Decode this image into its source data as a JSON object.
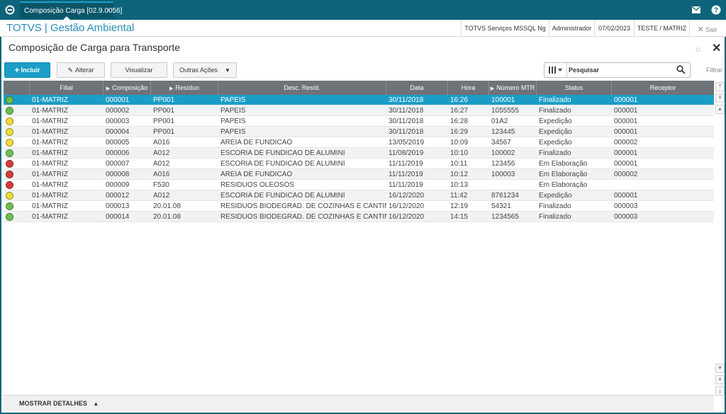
{
  "topbar": {
    "tab_label": "Composição Carga [02.9.0056]",
    "tab_close": "×"
  },
  "header": {
    "app_title": "TOTVS | Gestão Ambiental",
    "environment": "TOTVS Serviços MSSQL Ng",
    "user": "Administrador",
    "date": "07/02/2023",
    "company": "TESTE / MATRIZ",
    "exit_label": "Sair"
  },
  "page": {
    "title": "Composição de Carga para Transporte"
  },
  "toolbar": {
    "incluir": "Incluir",
    "alterar": "Alterar",
    "visualizar": "Visualizar",
    "outras_acoes": "Outras Ações",
    "search_placeholder": "Pesquisar",
    "filtrar": "Filtrar"
  },
  "grid": {
    "columns": [
      "",
      "Filial",
      "Composição",
      "Resíduo",
      "Desc. Resíd.",
      "Data",
      "Hora",
      "Número MTR",
      "Status",
      "Receptor"
    ],
    "rows": [
      {
        "status_color": "#6cc04a",
        "filial": "01-MATRIZ",
        "composicao": "000001",
        "residuo": "PP001",
        "desc": "PAPEIS",
        "data": "30/11/2018",
        "hora": "16:26",
        "mtr": "100001",
        "status": "Finalizado",
        "receptor": "000001"
      },
      {
        "status_color": "#6cc04a",
        "filial": "01-MATRIZ",
        "composicao": "000002",
        "residuo": "PP001",
        "desc": "PAPEIS",
        "data": "30/11/2018",
        "hora": "16:27",
        "mtr": "1055555",
        "status": "Finalizado",
        "receptor": "000001"
      },
      {
        "status_color": "#f0dc3c",
        "filial": "01-MATRIZ",
        "composicao": "000003",
        "residuo": "PP001",
        "desc": "PAPEIS",
        "data": "30/11/2018",
        "hora": "16:28",
        "mtr": "01A2",
        "status": "Expedição",
        "receptor": "000001"
      },
      {
        "status_color": "#f0dc3c",
        "filial": "01-MATRIZ",
        "composicao": "000004",
        "residuo": "PP001",
        "desc": "PAPEIS",
        "data": "30/11/2018",
        "hora": "16:29",
        "mtr": "123445",
        "status": "Expedição",
        "receptor": "000001"
      },
      {
        "status_color": "#f0dc3c",
        "filial": "01-MATRIZ",
        "composicao": "000005",
        "residuo": "A016",
        "desc": "AREIA DE FUNDICAO",
        "data": "13/05/2019",
        "hora": "10:09",
        "mtr": "34567",
        "status": "Expedição",
        "receptor": "000002"
      },
      {
        "status_color": "#6cc04a",
        "filial": "01-MATRIZ",
        "composicao": "000006",
        "residuo": "A012",
        "desc": "ESCORIA DE FUNDICAO DE ALUMINI",
        "data": "11/08/2019",
        "hora": "10:10",
        "mtr": "100002",
        "status": "Finalizado",
        "receptor": "000001"
      },
      {
        "status_color": "#d83a3a",
        "filial": "01-MATRIZ",
        "composicao": "000007",
        "residuo": "A012",
        "desc": "ESCORIA DE FUNDICAO DE ALUMINI",
        "data": "11/11/2019",
        "hora": "10:11",
        "mtr": "123456",
        "status": "Em Elaboração",
        "receptor": "000001"
      },
      {
        "status_color": "#d83a3a",
        "filial": "01-MATRIZ",
        "composicao": "000008",
        "residuo": "A016",
        "desc": "AREIA DE FUNDICAO",
        "data": "11/11/2019",
        "hora": "10:12",
        "mtr": "100003",
        "status": "Em Elaboração",
        "receptor": "000002"
      },
      {
        "status_color": "#d83a3a",
        "filial": "01-MATRIZ",
        "composicao": "000009",
        "residuo": "F530",
        "desc": "RESIDUOS OLEOSOS",
        "data": "11/11/2019",
        "hora": "10:13",
        "mtr": "",
        "status": "Em Elaboração",
        "receptor": ""
      },
      {
        "status_color": "#f0dc3c",
        "filial": "01-MATRIZ",
        "composicao": "000012",
        "residuo": "A012",
        "desc": "ESCORIA DE FUNDICAO DE ALUMINI",
        "data": "16/12/2020",
        "hora": "11:42",
        "mtr": "8761234",
        "status": "Expedição",
        "receptor": "000001"
      },
      {
        "status_color": "#6cc04a",
        "filial": "01-MATRIZ",
        "composicao": "000013",
        "residuo": "20.01.08",
        "desc": "RESIDUOS BIODEGRAD. DE COZINHAS E CANTIN",
        "data": "16/12/2020",
        "hora": "12:19",
        "mtr": "54321",
        "status": "Finalizado",
        "receptor": "000003"
      },
      {
        "status_color": "#6cc04a",
        "filial": "01-MATRIZ",
        "composicao": "000014",
        "residuo": "20.01.08",
        "desc": "RESIDUOS BIODEGRAD. DE COZINHAS E CANTIN",
        "data": "16/12/2020",
        "hora": "14:15",
        "mtr": "1234565",
        "status": "Finalizado",
        "receptor": "000003"
      }
    ]
  },
  "footer": {
    "mostrar_detalhes": "MOSTRAR DETALHES"
  },
  "colors": {
    "topbar": "#0d6379",
    "accent": "#1b9dc7",
    "header_text": "#2a8cb7",
    "grid_header": "#6e7378",
    "status_green": "#6cc04a",
    "status_yellow": "#f0dc3c",
    "status_red": "#d83a3a"
  }
}
